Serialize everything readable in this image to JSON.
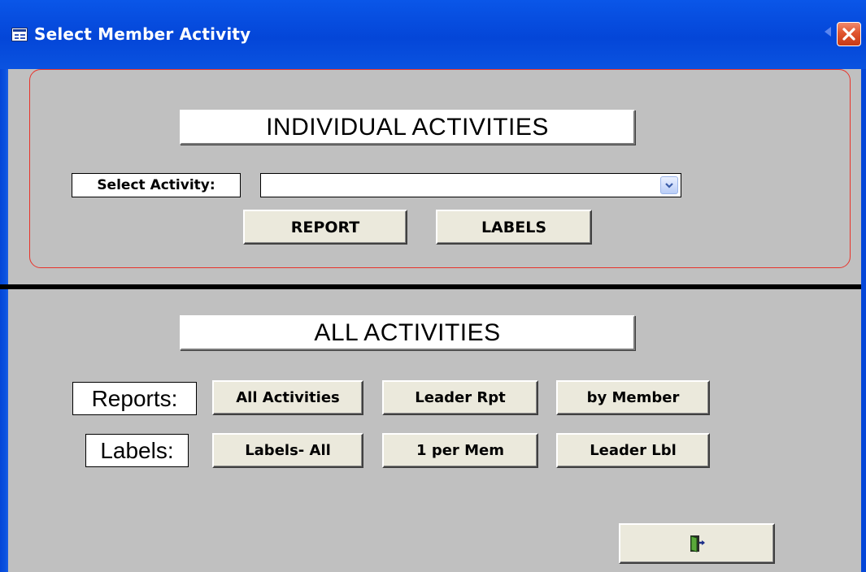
{
  "window": {
    "title": "Select Member Activity",
    "icon": "form-icon",
    "close_icon": "close-icon"
  },
  "individual": {
    "heading": "INDIVIDUAL ACTIVITIES",
    "select_label": "Select Activity:",
    "activity_value": "",
    "report_button": "REPORT",
    "labels_button": "LABELS"
  },
  "all": {
    "heading": "ALL ACTIVITIES",
    "reports_label": "Reports:",
    "labels_label": "Labels:",
    "reports_buttons": [
      "All Activities",
      "Leader Rpt",
      "by Member"
    ],
    "labels_buttons": [
      "Labels- All",
      "1 per Mem",
      "Leader Lbl"
    ]
  },
  "footer": {
    "exit_icon": "exit-door-icon"
  },
  "colors": {
    "titlebar": "#0446d8",
    "client_bg": "#c0c0c0",
    "button_bg": "#ebe9dc",
    "group_border": "#e8332a",
    "close_button": "#e0552f"
  }
}
